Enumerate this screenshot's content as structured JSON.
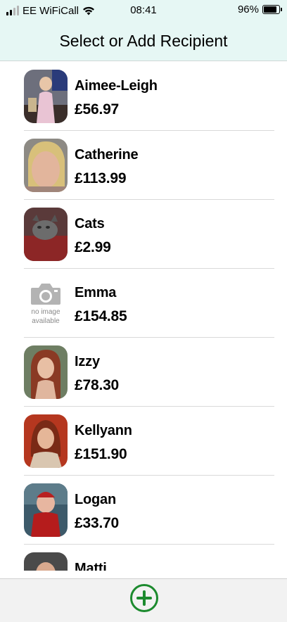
{
  "status_bar": {
    "carrier": "EE WiFiCall",
    "time": "08:41",
    "battery_percent": "96%",
    "battery_level": 0.96
  },
  "header": {
    "title": "Select or Add Recipient"
  },
  "recipients": [
    {
      "name": "Aimee-Leigh",
      "amount": "£56.97",
      "avatar": "photo"
    },
    {
      "name": "Catherine",
      "amount": "£113.99",
      "avatar": "photo"
    },
    {
      "name": "Cats",
      "amount": "£2.99",
      "avatar": "photo"
    },
    {
      "name": "Emma",
      "amount": "£154.85",
      "avatar": "no-image",
      "no_image_text": "no image available"
    },
    {
      "name": "Izzy",
      "amount": "£78.30",
      "avatar": "photo"
    },
    {
      "name": "Kellyann",
      "amount": "£151.90",
      "avatar": "photo"
    },
    {
      "name": "Logan",
      "amount": "£33.70",
      "avatar": "photo"
    },
    {
      "name": "Matti",
      "amount": "",
      "avatar": "photo"
    }
  ],
  "colors": {
    "header_bg": "#e6f7f4",
    "add_button": "#1c8a2e"
  },
  "footer": {
    "add_icon": "plus-circle-icon"
  }
}
